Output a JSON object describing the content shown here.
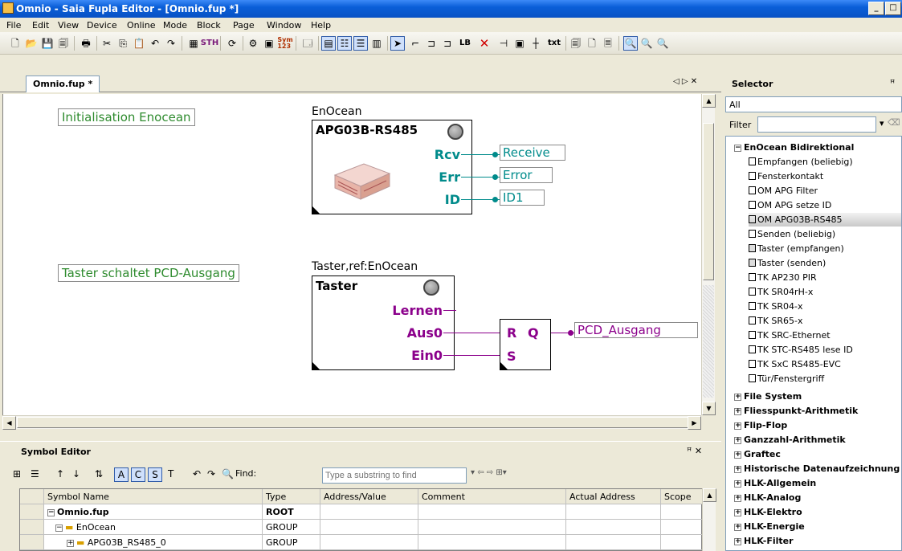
{
  "window": {
    "title": "Omnio - Saia Fupla Editor - [Omnio.fup *]",
    "min_label": "_",
    "max_label": "□"
  },
  "menu": [
    "File",
    "Edit",
    "View",
    "Device",
    "Online",
    "Mode",
    "Block",
    "Page",
    "Window",
    "Help"
  ],
  "toolbar_text": {
    "sym_badge": "Sym\n123",
    "lb": "LB",
    "txt": "txt",
    "sth": "STH"
  },
  "doc_tab": {
    "label": "Omnio.fup *",
    "nav": "◁ ▷ ✕"
  },
  "canvas": {
    "comments": [
      "Initialisation Enocean",
      "Taster schaltet PCD-Ausgang"
    ],
    "block1": {
      "caption": "EnOcean",
      "name": "APG03B-RS485",
      "pins": [
        "Rcv",
        "Err",
        "ID"
      ],
      "outputs": [
        "Receive",
        "Error",
        "ID1"
      ]
    },
    "block2": {
      "caption": "Taster,ref:EnOcean",
      "name": "Taster",
      "pins": [
        "Lernen",
        "Aus0",
        "Ein0"
      ]
    },
    "flipflop": {
      "r": "R",
      "q": "Q",
      "s": "S",
      "output": "PCD_Ausgang"
    }
  },
  "symbol_editor": {
    "title": "Symbol Editor",
    "pin_close": "ꟸ ✕",
    "filter_buttons": [
      "A",
      "C",
      "S",
      "T"
    ],
    "find_label": "Find:",
    "find_placeholder": "Type a substring to find",
    "columns": [
      "Symbol Name",
      "Type",
      "Address/Value",
      "Comment",
      "Actual Address",
      "Scope"
    ],
    "rows": [
      {
        "name": "Omnio.fup",
        "type": "ROOT"
      },
      {
        "name": "EnOcean",
        "type": "GROUP"
      },
      {
        "name": "APG03B_RS485_0",
        "type": "GROUP"
      }
    ]
  },
  "selector": {
    "title": "Selector",
    "pin": "ꟸ",
    "all": "All",
    "filter_label": "Filter",
    "open_group": "EnOcean Bidirektional",
    "items": [
      "Empfangen (beliebig)",
      "Fensterkontakt",
      "OM APG Filter",
      "OM APG setze ID",
      "OM APG03B-RS485",
      "Senden (beliebig)",
      "Taster (empfangen)",
      "Taster (senden)",
      "TK AP230 PIR",
      "TK SR04rH-x",
      "TK SR04-x",
      "TK SR65-x",
      "TK SRC-Ethernet",
      "TK STC-RS485 lese ID",
      "TK SxC RS485-EVC",
      "Tür/Fenstergriff"
    ],
    "selected_item": "OM APG03B-RS485",
    "groups": [
      "File System",
      "Fliesspunkt-Arithmetik",
      "Flip-Flop",
      "Ganzzahl-Arithmetik",
      "Graftec",
      "Historische Datenaufzeichnung",
      "HLK-Allgemein",
      "HLK-Analog",
      "HLK-Elektro",
      "HLK-Energie",
      "HLK-Filter"
    ]
  },
  "colors": {
    "comment": "#2e8b2e",
    "enocean_pin": "#008b8b",
    "taster_pin": "#8b008b",
    "title_bar": "#0a5fd8"
  }
}
